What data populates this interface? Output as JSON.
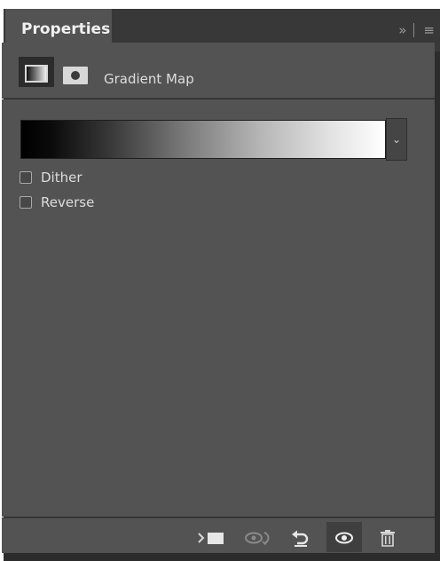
{
  "panel": {
    "tab_label": "Properties",
    "tab_controls": {
      "collapse": "»",
      "menu": "≡"
    }
  },
  "adjustment": {
    "title": "Gradient Map",
    "icons": [
      "gradient-map-adjustment-icon",
      "layer-mask-icon"
    ]
  },
  "gradient": {
    "start_color": "#000000",
    "end_color": "#ffffff"
  },
  "options": {
    "dither_label": "Dither",
    "dither_checked": false,
    "reverse_label": "Reverse",
    "reverse_checked": false
  },
  "footer_icons": [
    "clip-to-layer-icon",
    "view-previous-state-icon",
    "reset-icon",
    "visibility-eye-icon",
    "trash-icon"
  ],
  "colors": {
    "panel_bg": "#535353",
    "tab_bar_bg": "#383838",
    "text": "#dddddd"
  }
}
